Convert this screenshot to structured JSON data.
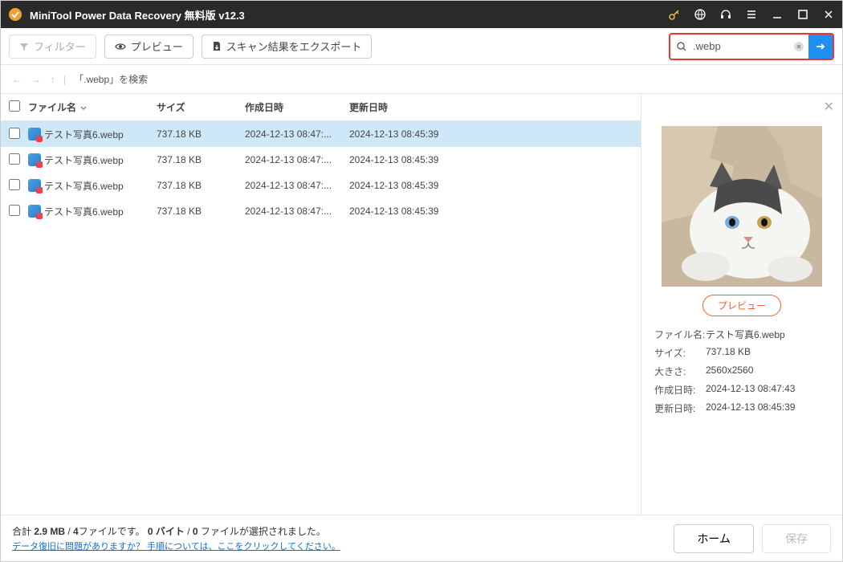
{
  "titlebar": {
    "title": "MiniTool Power Data Recovery 無料版 v12.3"
  },
  "toolbar": {
    "filter": "フィルター",
    "preview": "プレビュー",
    "export": "スキャン結果をエクスポート"
  },
  "search": {
    "value": ".webp"
  },
  "breadcrumb": {
    "text": "「.webp」を検索"
  },
  "columns": {
    "name": "ファイル名",
    "size": "サイズ",
    "created": "作成日時",
    "updated": "更新日時"
  },
  "rows": [
    {
      "name": "テスト写真6.webp",
      "size": "737.18 KB",
      "created": "2024-12-13 08:47:...",
      "updated": "2024-12-13 08:45:39",
      "selected": true
    },
    {
      "name": "テスト写真6.webp",
      "size": "737.18 KB",
      "created": "2024-12-13 08:47:...",
      "updated": "2024-12-13 08:45:39",
      "selected": false
    },
    {
      "name": "テスト写真6.webp",
      "size": "737.18 KB",
      "created": "2024-12-13 08:47:...",
      "updated": "2024-12-13 08:45:39",
      "selected": false
    },
    {
      "name": "テスト写真6.webp",
      "size": "737.18 KB",
      "created": "2024-12-13 08:47:...",
      "updated": "2024-12-13 08:45:39",
      "selected": false
    }
  ],
  "preview": {
    "button": "プレビュー",
    "meta": {
      "name_label": "ファイル名:",
      "name": "テスト写真6.webp",
      "size_label": "サイズ:",
      "size": "737.18 KB",
      "dim_label": "大きさ:",
      "dim": "2560x2560",
      "created_label": "作成日時:",
      "created": "2024-12-13 08:47:43",
      "updated_label": "更新日時:",
      "updated": "2024-12-13 08:45:39"
    }
  },
  "footer": {
    "status_prefix": "合計 ",
    "status_total": "2.9 MB",
    "status_mid1": " / ",
    "status_files": "4",
    "status_mid2": "ファイルです。 ",
    "status_selbytes": "0 バイト",
    "status_mid3": " / ",
    "status_selcount": "0",
    "status_suffix": " ファイルが選択されました。",
    "help": "データ復旧に問題がありますか？ 手順については、ここをクリックしてください。",
    "home": "ホーム",
    "save": "保存"
  }
}
